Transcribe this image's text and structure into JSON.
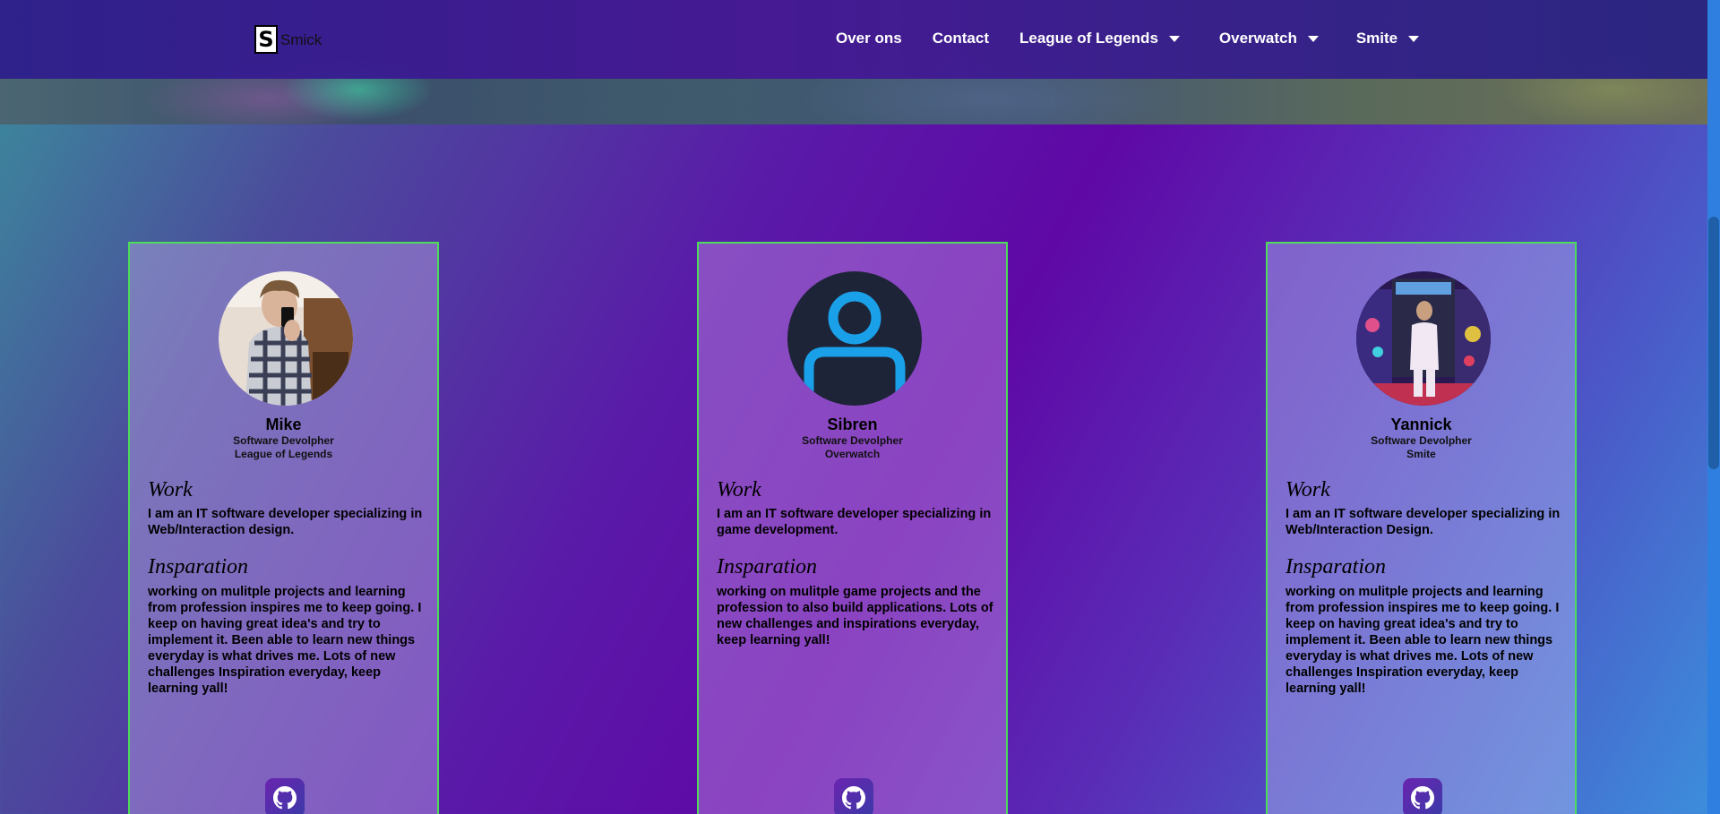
{
  "site": {
    "logo_letter": "S",
    "logo_text": "Smick"
  },
  "nav": {
    "items": [
      {
        "label": "Over ons",
        "dropdown": false
      },
      {
        "label": "Contact",
        "dropdown": false
      },
      {
        "label": "League of Legends",
        "dropdown": true
      },
      {
        "label": "Overwatch",
        "dropdown": true
      },
      {
        "label": "Smite",
        "dropdown": true
      }
    ]
  },
  "team": [
    {
      "name": "Mike",
      "role": "Software Devolpher",
      "game": "League of Legends",
      "work_heading": "Work",
      "work_text": "I am an IT software developer specializing in Web/Interaction design.",
      "inspiration_heading": "Insparation",
      "inspiration_text": "working on mulitple projects and learning from profession inspires me to keep going. I keep on having great idea's and try to implement it. Been able to learn new things everyday is what drives me. Lots of new challenges Inspiration everyday, keep learning yall!",
      "avatar_icon": "photo-avatar",
      "link_icon": "github-icon"
    },
    {
      "name": "Sibren",
      "role": "Software Devolpher",
      "game": "Overwatch",
      "work_heading": "Work",
      "work_text": "I am an IT software developer specializing in game development.",
      "inspiration_heading": "Insparation",
      "inspiration_text": "working on mulitple game projects and the profession to also build applications. Lots of new challenges and inspirations everyday, keep learning yall!",
      "avatar_icon": "default-user-icon",
      "link_icon": "github-icon"
    },
    {
      "name": "Yannick",
      "role": "Software Devolpher",
      "game": "Smite",
      "work_heading": "Work",
      "work_text": "I am an IT software developer specializing in Web/Interaction Design.",
      "inspiration_heading": "Insparation",
      "inspiration_text": "working on mulitple projects and learning from profession inspires me to keep going. I keep on having great idea's and try to implement it. Been able to learn new things everyday is what drives me. Lots of new challenges Inspiration everyday, keep learning yall!",
      "avatar_icon": "photo-avatar",
      "link_icon": "github-icon"
    }
  ],
  "colors": {
    "nav_bg": "#3a1e8c",
    "card_border": "#4ddc5a",
    "github_button": "#5a28ac"
  }
}
